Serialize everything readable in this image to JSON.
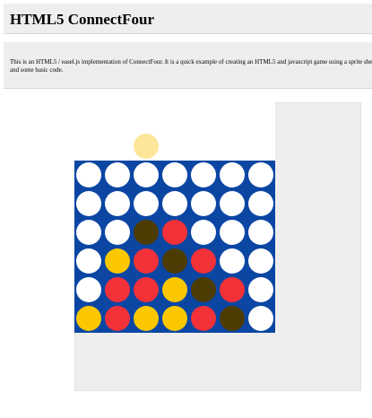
{
  "header": {
    "title": "HTML5 ConnectFour"
  },
  "description": {
    "text": "This is an HTML5 / easel.js implementation of ConnectFour. It is a quick example of creating an HTML5 and javascript game using a sprite sheet and some basic code."
  },
  "colors": {
    "board": "#0b46a3",
    "empty": "#ffffff",
    "red": "#f23139",
    "yellow": "#fbc800",
    "dark": "#4d3b04",
    "preview": "#fde59a"
  },
  "game": {
    "columns": 7,
    "rows": 6,
    "preview_column": 2,
    "preview_color": "preview",
    "board": [
      [
        "empty",
        "empty",
        "empty",
        "empty",
        "empty",
        "empty",
        "empty"
      ],
      [
        "empty",
        "empty",
        "empty",
        "empty",
        "empty",
        "empty",
        "empty"
      ],
      [
        "empty",
        "empty",
        "dark",
        "red",
        "empty",
        "empty",
        "empty"
      ],
      [
        "empty",
        "yellow",
        "red",
        "dark",
        "red",
        "empty",
        "empty"
      ],
      [
        "empty",
        "red",
        "red",
        "yellow",
        "dark",
        "red",
        "empty"
      ],
      [
        "yellow",
        "red",
        "yellow",
        "yellow",
        "red",
        "dark",
        "empty"
      ]
    ]
  }
}
